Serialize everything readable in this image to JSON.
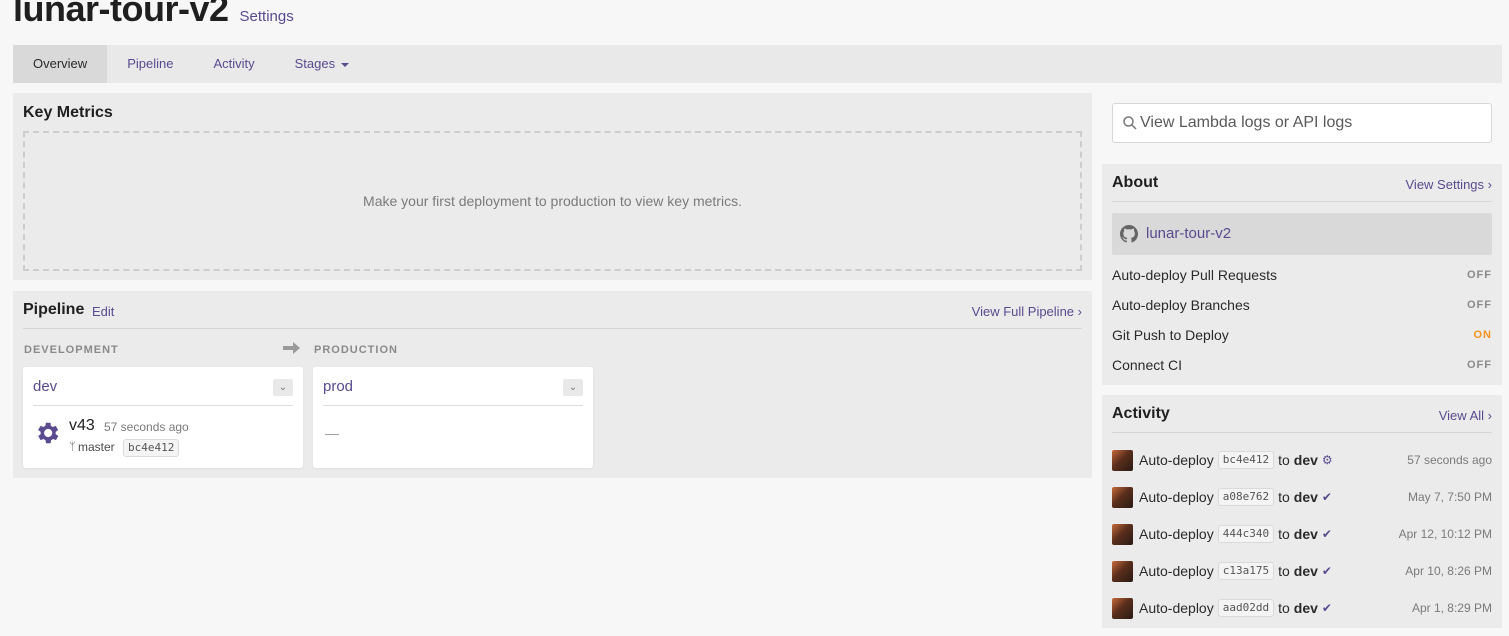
{
  "app": {
    "title": "lunar-tour-v2",
    "settings_link": "Settings"
  },
  "tabs": [
    {
      "label": "Overview",
      "active": true
    },
    {
      "label": "Pipeline",
      "active": false
    },
    {
      "label": "Activity",
      "active": false
    },
    {
      "label": "Stages",
      "active": false,
      "dropdown": true
    }
  ],
  "key_metrics": {
    "title": "Key Metrics",
    "empty_message": "Make your first deployment to production to view key metrics."
  },
  "pipeline": {
    "title": "Pipeline",
    "edit_label": "Edit",
    "view_full_label": "View Full Pipeline",
    "arrow_icon": "arrow-right-icon",
    "stages": [
      {
        "label": "DEVELOPMENT",
        "name": "dev",
        "version": "v43",
        "time": "57 seconds ago",
        "branch": "master",
        "sha": "bc4e412",
        "status_icon": "gear-icon"
      },
      {
        "label": "PRODUCTION",
        "name": "prod",
        "empty": "—"
      }
    ]
  },
  "search": {
    "placeholder": "View Lambda logs or API logs",
    "value": ""
  },
  "about": {
    "title": "About",
    "view_settings_label": "View Settings",
    "repo": {
      "icon": "github-icon",
      "name": "lunar-tour-v2"
    },
    "settings": [
      {
        "label": "Auto-deploy Pull Requests",
        "value": "OFF"
      },
      {
        "label": "Auto-deploy Branches",
        "value": "OFF"
      },
      {
        "label": "Git Push to Deploy",
        "value": "ON"
      },
      {
        "label": "Connect CI",
        "value": "OFF"
      }
    ]
  },
  "activity": {
    "title": "Activity",
    "view_all_label": "View All",
    "items": [
      {
        "action": "Auto-deploy",
        "sha": "bc4e412",
        "to": "to",
        "stage": "dev",
        "status_icon": "gear-icon",
        "time": "57 seconds ago"
      },
      {
        "action": "Auto-deploy",
        "sha": "a08e762",
        "to": "to",
        "stage": "dev",
        "status_icon": "check-icon",
        "time": "May 7, 7:50 PM"
      },
      {
        "action": "Auto-deploy",
        "sha": "444c340",
        "to": "to",
        "stage": "dev",
        "status_icon": "check-icon",
        "time": "Apr 12, 10:12 PM"
      },
      {
        "action": "Auto-deploy",
        "sha": "c13a175",
        "to": "to",
        "stage": "dev",
        "status_icon": "check-icon",
        "time": "Apr 10, 8:26 PM"
      },
      {
        "action": "Auto-deploy",
        "sha": "aad02dd",
        "to": "to",
        "stage": "dev",
        "status_icon": "check-icon",
        "time": "Apr 1, 8:29 PM"
      }
    ]
  },
  "colors": {
    "accent": "#5a4a8e",
    "on": "#f5921e",
    "off": "#8a8a8a",
    "panel": "#ebebeb"
  }
}
